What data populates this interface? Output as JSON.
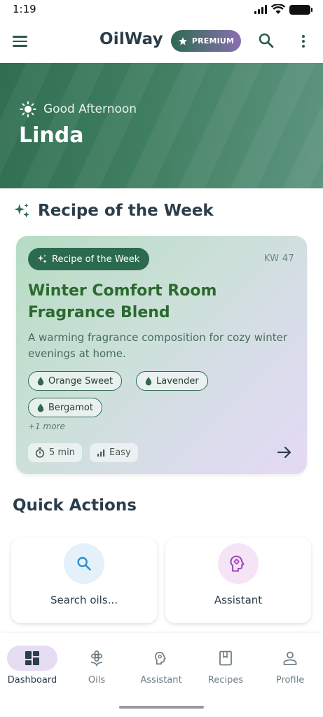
{
  "status_bar": {
    "time": "1:19"
  },
  "app_bar": {
    "title": "OilWay",
    "premium_label": "PREMIUM"
  },
  "hero": {
    "greeting": "Good Afternoon",
    "name": "Linda"
  },
  "recipe_section": {
    "title": "Recipe of the Week"
  },
  "recipe_card": {
    "badge": "Recipe of the Week",
    "week": "KW 47",
    "title": "Winter Comfort Room Fragrance Blend",
    "description": "A warming fragrance composition for cozy winter evenings at home.",
    "oils": [
      "Orange Sweet",
      "Lavender",
      "Bergamot"
    ],
    "more": "+1 more",
    "duration": "5 min",
    "difficulty": "Easy"
  },
  "quick_actions": {
    "title": "Quick Actions",
    "items": [
      {
        "label": "Search oils...",
        "icon": "search-icon",
        "color": "#2f8fd0"
      },
      {
        "label": "Assistant",
        "icon": "psychology-icon",
        "color": "#a04ab8"
      }
    ]
  },
  "bottom_nav": {
    "items": [
      {
        "label": "Dashboard",
        "icon": "dashboard-icon",
        "active": true
      },
      {
        "label": "Oils",
        "icon": "flower-icon"
      },
      {
        "label": "Assistant",
        "icon": "psychology-icon"
      },
      {
        "label": "Recipes",
        "icon": "book-icon"
      },
      {
        "label": "Profile",
        "icon": "person-icon"
      }
    ]
  },
  "colors": {
    "primary": "#2c6a50",
    "accent": "#8a6fb0",
    "text": "#2c3d4a"
  }
}
